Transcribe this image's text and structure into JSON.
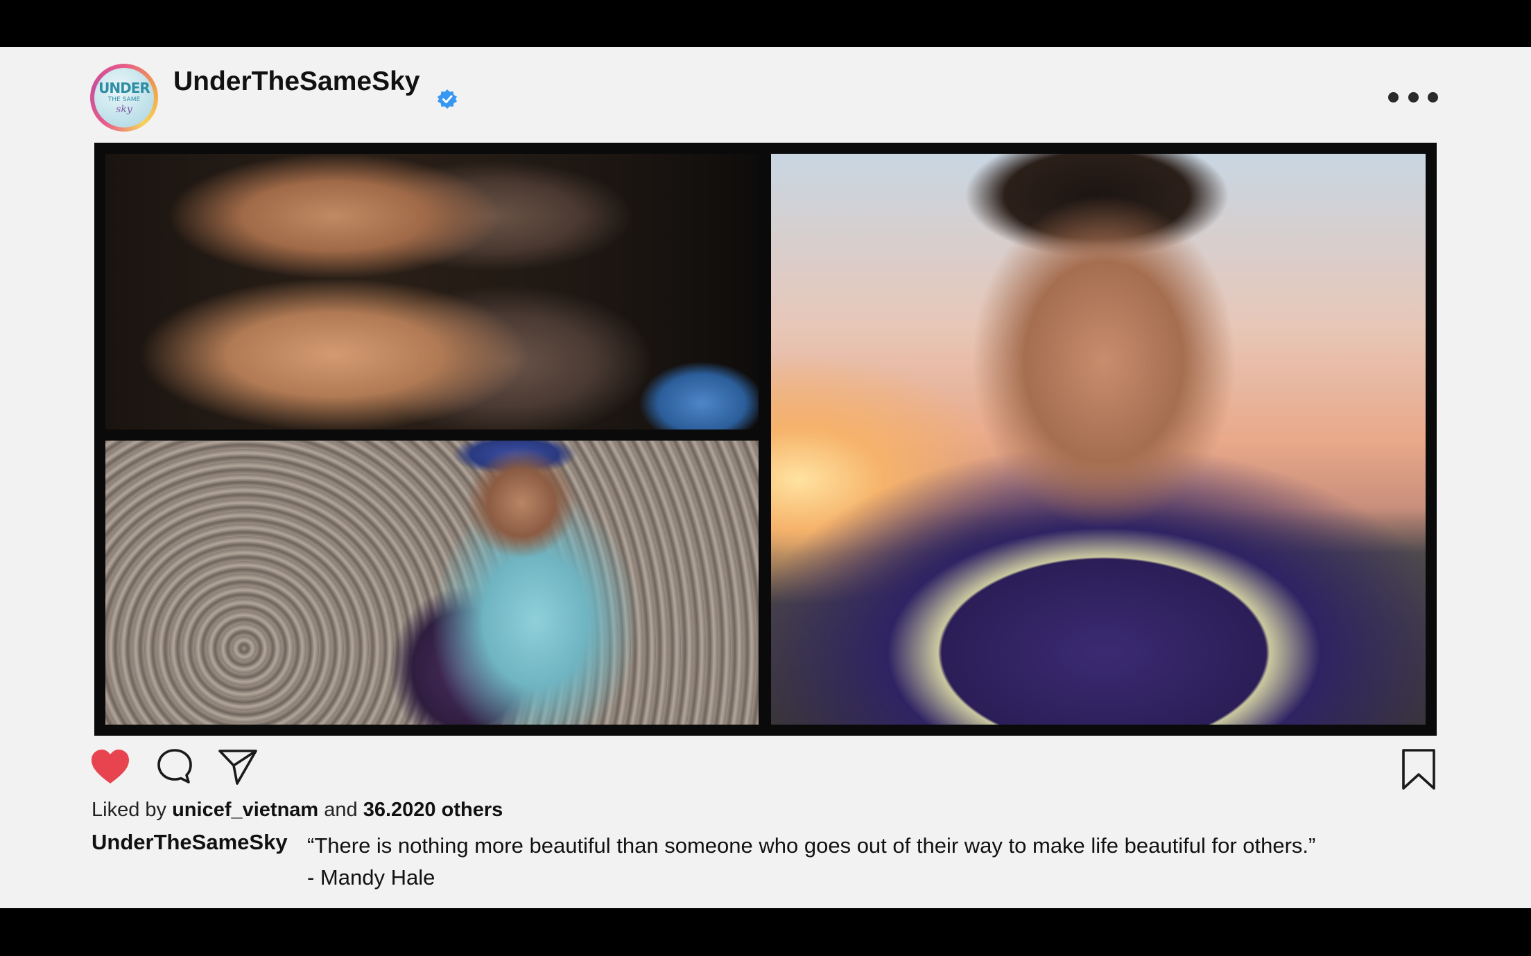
{
  "post": {
    "account": {
      "username": "UnderTheSameSky",
      "verified": true,
      "avatar_text_line1": "UNDER",
      "avatar_text_line2": "THE SAME",
      "avatar_text_line3": "sky"
    },
    "more_icon": "more-horizontal-icon",
    "media": [
      {
        "name": "hands-photo"
      },
      {
        "name": "child-on-rocks-photo"
      },
      {
        "name": "smiling-man-sunset-photo"
      }
    ],
    "actions": {
      "like_icon": "heart-icon",
      "comment_icon": "comment-icon",
      "share_icon": "paper-plane-icon",
      "save_icon": "bookmark-icon",
      "liked": true,
      "like_color": "#e8444f"
    },
    "likes": {
      "prefix": "Liked by",
      "liker": "unicef_vietnam",
      "joiner": "and",
      "others": "36.2020 others"
    },
    "caption": {
      "username": "UnderTheSameSky",
      "line1": "“There is nothing more beautiful than someone who goes out of their way to make life beautiful for others.”",
      "line2": "- Mandy Hale"
    }
  }
}
